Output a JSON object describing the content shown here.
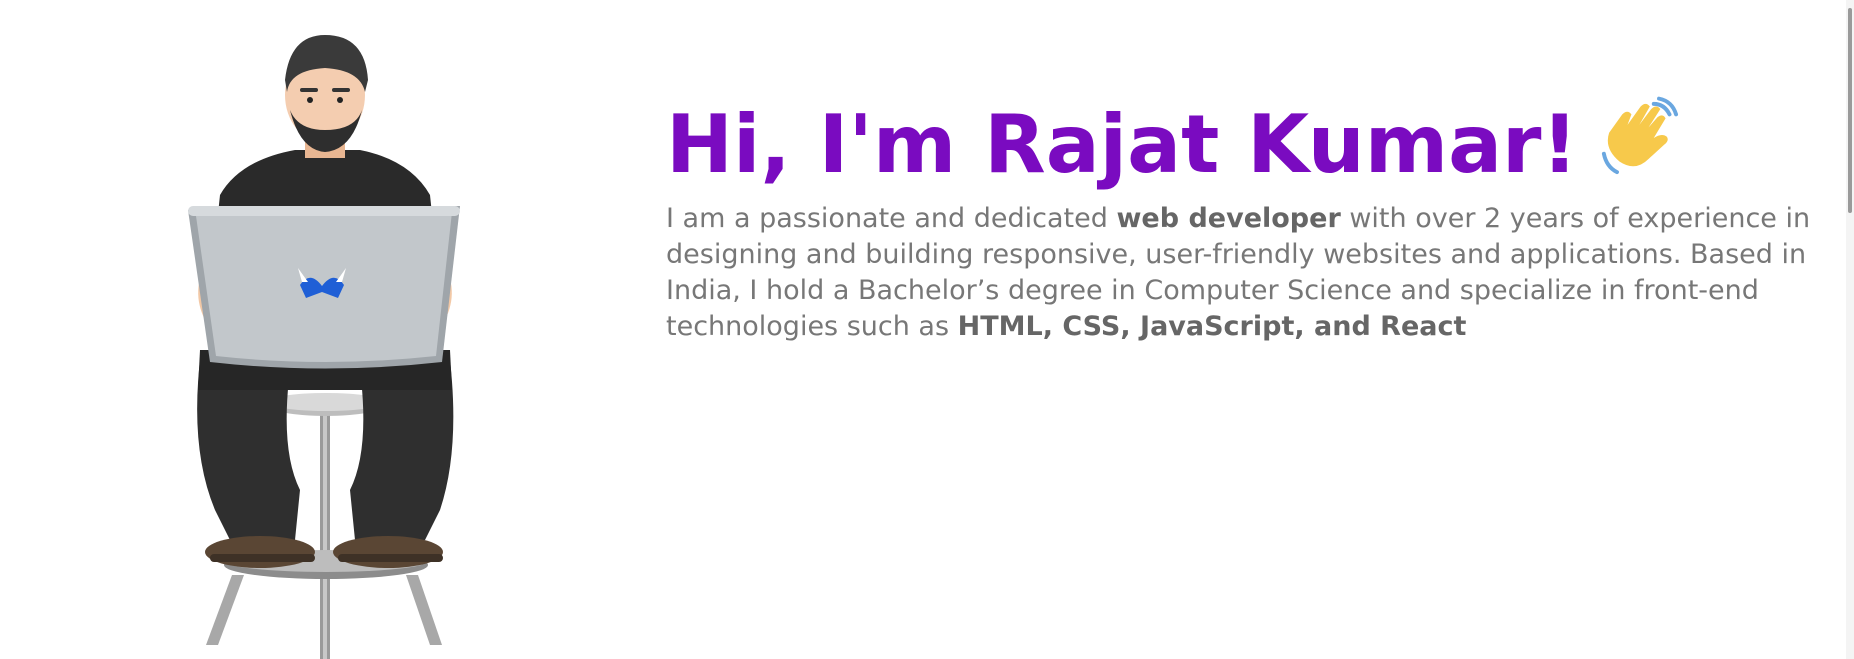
{
  "hero": {
    "greeting": "Hi, I'm Rajat Kumar!",
    "wave_icon": "waving-hand-icon",
    "illustration_icon": "developer-with-laptop-illustration",
    "laptop_logo_icon": "m-logo-icon",
    "bio_intro": "I am a passionate and dedicated ",
    "bio_highlight_role": "web developer",
    "bio_middle": " with over 2 years of experience in designing and building responsive, user-friendly websites and applications. Based in India, I hold a Bachelor’s degree in Computer Science and specialize in front-end technologies such as ",
    "bio_highlight_skills": "HTML, CSS, JavaScript, and React"
  },
  "colors": {
    "heading": "#7a0bc0",
    "body_text": "#777777",
    "body_bold": "#666666",
    "scrollbar_track": "#f4f4f4",
    "scrollbar_thumb": "#9a9a9a"
  }
}
